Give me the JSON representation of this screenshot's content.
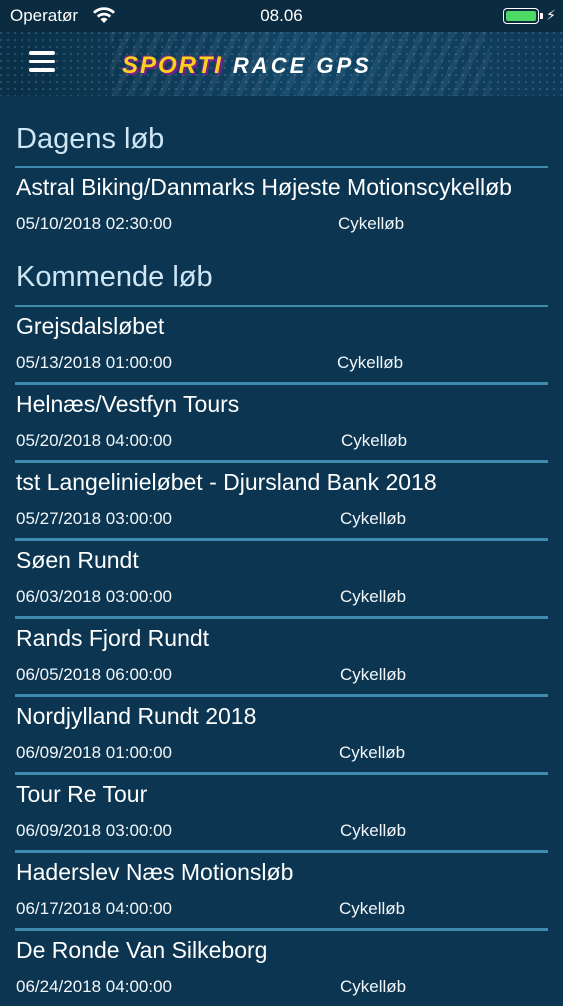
{
  "status_bar": {
    "carrier": "Operatør",
    "time": "08.06",
    "battery_level": 1.0
  },
  "header": {
    "logo_part1": "SPORTI",
    "logo_part2": "RACE GPS",
    "menu_icon": "hamburger-menu-icon"
  },
  "today": {
    "title": "Dagens løb",
    "races": [
      {
        "name": "Astral Biking/Danmarks Højeste Motionscykelløb",
        "date": "05/10/2018 02:30:00",
        "type": "Cykelløb"
      }
    ]
  },
  "upcoming": {
    "title": "Kommende løb",
    "races": [
      {
        "name": "Grejsdalsløbet",
        "date": "05/13/2018 01:00:00",
        "type": "Cykelløb"
      },
      {
        "name": "Helnæs/Vestfyn Tours",
        "date": "05/20/2018 04:00:00",
        "type": "Cykelløb"
      },
      {
        "name": "tst Langelinieløbet - Djursland Bank 2018",
        "date": "05/27/2018 03:00:00",
        "type": "Cykelløb"
      },
      {
        "name": "Søen Rundt",
        "date": "06/03/2018 03:00:00",
        "type": "Cykelløb"
      },
      {
        "name": "Rands Fjord Rundt",
        "date": "06/05/2018 06:00:00",
        "type": "Cykelløb"
      },
      {
        "name": "Nordjylland Rundt 2018",
        "date": "06/09/2018 01:00:00",
        "type": "Cykelløb"
      },
      {
        "name": "Tour Re Tour",
        "date": "06/09/2018 03:00:00",
        "type": "Cykelløb"
      },
      {
        "name": "Haderslev Næs Motionsløb",
        "date": "06/17/2018 04:00:00",
        "type": "Cykelløb"
      },
      {
        "name": "De Ronde Van Silkeborg",
        "date": "06/24/2018 04:00:00",
        "type": "Cykelløb"
      }
    ]
  }
}
